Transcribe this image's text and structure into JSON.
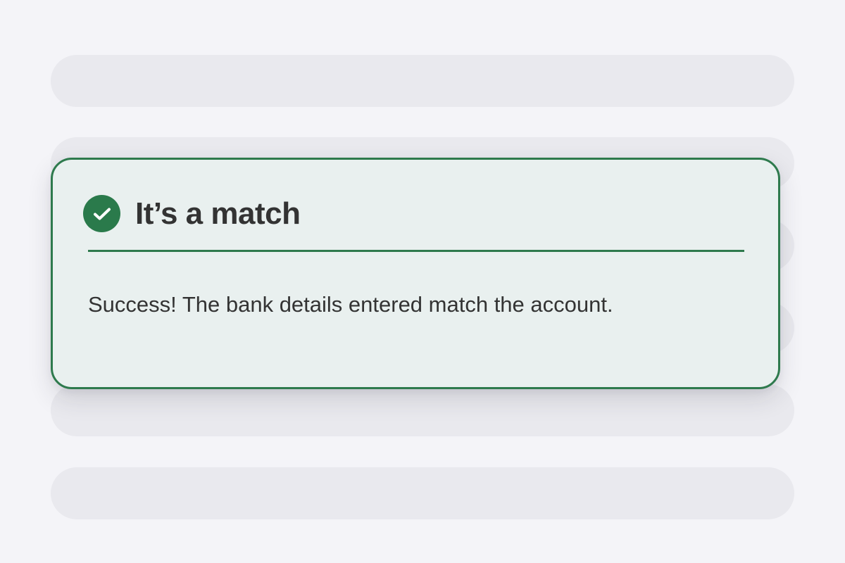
{
  "colors": {
    "page_background": "#f4f4f8",
    "placeholder_bar": "#e9e9ee",
    "card_background": "#e9f0ef",
    "success_green": "#2e7a4d",
    "text": "#333333"
  },
  "alert": {
    "icon": "check-circle-icon",
    "title": "It’s a match",
    "message": "Success! The bank details entered match the account."
  }
}
